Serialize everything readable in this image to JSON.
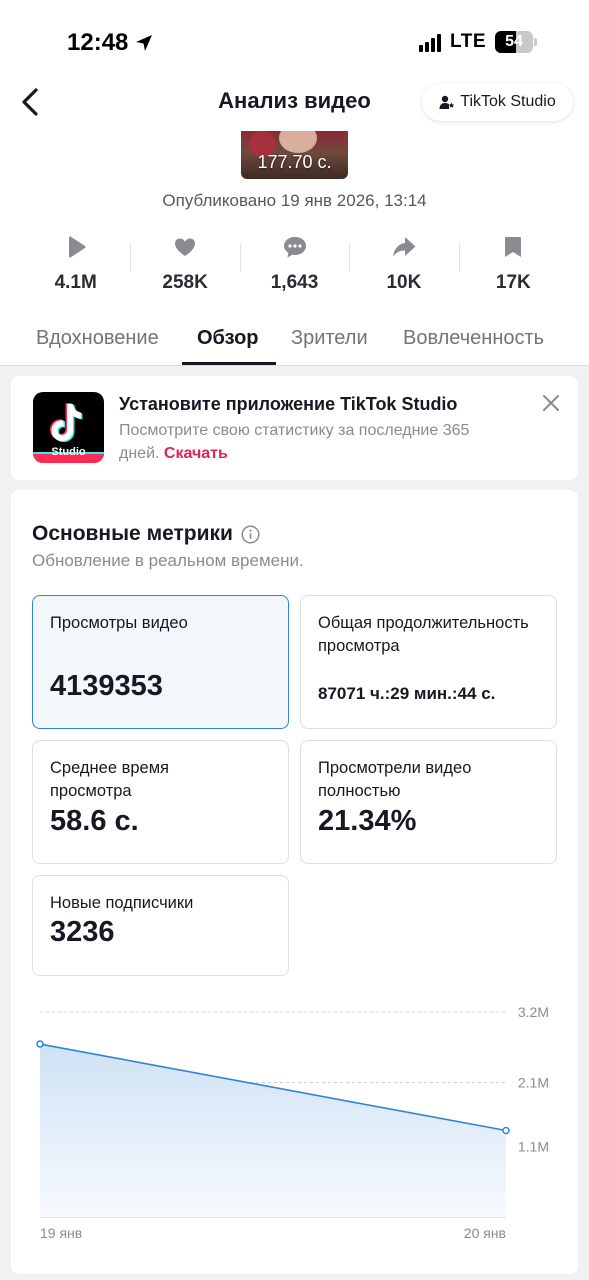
{
  "status_bar": {
    "time": "12:48",
    "network": "LTE",
    "battery": "54",
    "battery_level": 0.54
  },
  "header": {
    "title": "Анализ видео",
    "studio_button": "TikTok Studio"
  },
  "video": {
    "duration": "177.70 с.",
    "published": "Опубликовано 19 янв 2026, 13:14"
  },
  "stats": [
    {
      "icon": "play-icon",
      "value": "4.1M"
    },
    {
      "icon": "heart-icon",
      "value": "258K"
    },
    {
      "icon": "comment-icon",
      "value": "1,643"
    },
    {
      "icon": "share-icon",
      "value": "10K"
    },
    {
      "icon": "bookmark-icon",
      "value": "17K"
    }
  ],
  "tabs": [
    {
      "label": "Вдохновение",
      "active": false
    },
    {
      "label": "Обзор",
      "active": true
    },
    {
      "label": "Зрители",
      "active": false
    },
    {
      "label": "Вовлеченность",
      "active": false
    }
  ],
  "promo": {
    "title": "Установите приложение TikTok Studio",
    "description": "Посмотрите свою статистику за последние 365 дней.",
    "link": "Скачать",
    "logo_label": "Studio"
  },
  "metrics": {
    "title": "Основные метрики",
    "subtitle": "Обновление в реальном времени.",
    "cards": {
      "views": {
        "label": "Просмотры видео",
        "value": "4139353"
      },
      "total_watch": {
        "label": "Общая продолжительность просмотра",
        "value": "87071 ч.:29 мин.:44 с."
      },
      "avg_watch": {
        "label": "Среднее время просмотра",
        "value": "58.6 с."
      },
      "full_watch": {
        "label": "Просмотрели видео полностью",
        "value": "21.34%"
      },
      "followers": {
        "label": "Новые подписчики",
        "value": "3236"
      }
    }
  },
  "chart_data": {
    "type": "area",
    "x": [
      "19 янв",
      "20 янв"
    ],
    "values": [
      2700000,
      1350000
    ],
    "y_ticks": [
      "3.2M",
      "2.1M",
      "1.1M"
    ],
    "y_tick_values": [
      3200000,
      2100000,
      1100000
    ],
    "ylim": [
      0,
      3200000
    ],
    "grid": true,
    "color": "#2f84d4"
  }
}
